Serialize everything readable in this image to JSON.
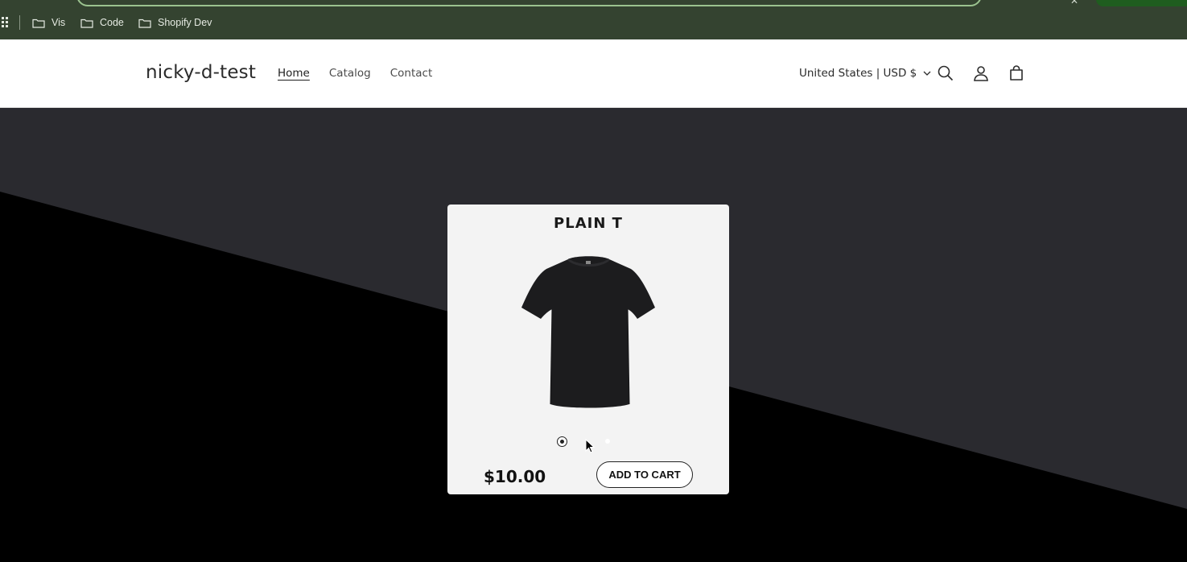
{
  "browser": {
    "bookmarks": [
      {
        "label": "Vis",
        "icon": "folder-icon"
      },
      {
        "label": "Code",
        "icon": "folder-icon"
      },
      {
        "label": "Shopify Dev",
        "icon": "folder-icon"
      }
    ]
  },
  "header": {
    "store_name": "nicky-d-test",
    "nav": [
      {
        "label": "Home",
        "active": true
      },
      {
        "label": "Catalog",
        "active": false
      },
      {
        "label": "Contact",
        "active": false
      }
    ],
    "currency": "United States | USD $",
    "icons": [
      "search-icon",
      "account-icon",
      "cart-icon"
    ]
  },
  "product": {
    "title": "PLAIN T",
    "price": "$10.00",
    "add_to_cart": "ADD TO CART",
    "variant_count": 3,
    "selected_variant": 1
  },
  "colors": {
    "chrome_bg": "#344330",
    "hero_dark": "#2a2a2f",
    "hero_black": "#000000",
    "card_bg": "#f3f3f3"
  }
}
